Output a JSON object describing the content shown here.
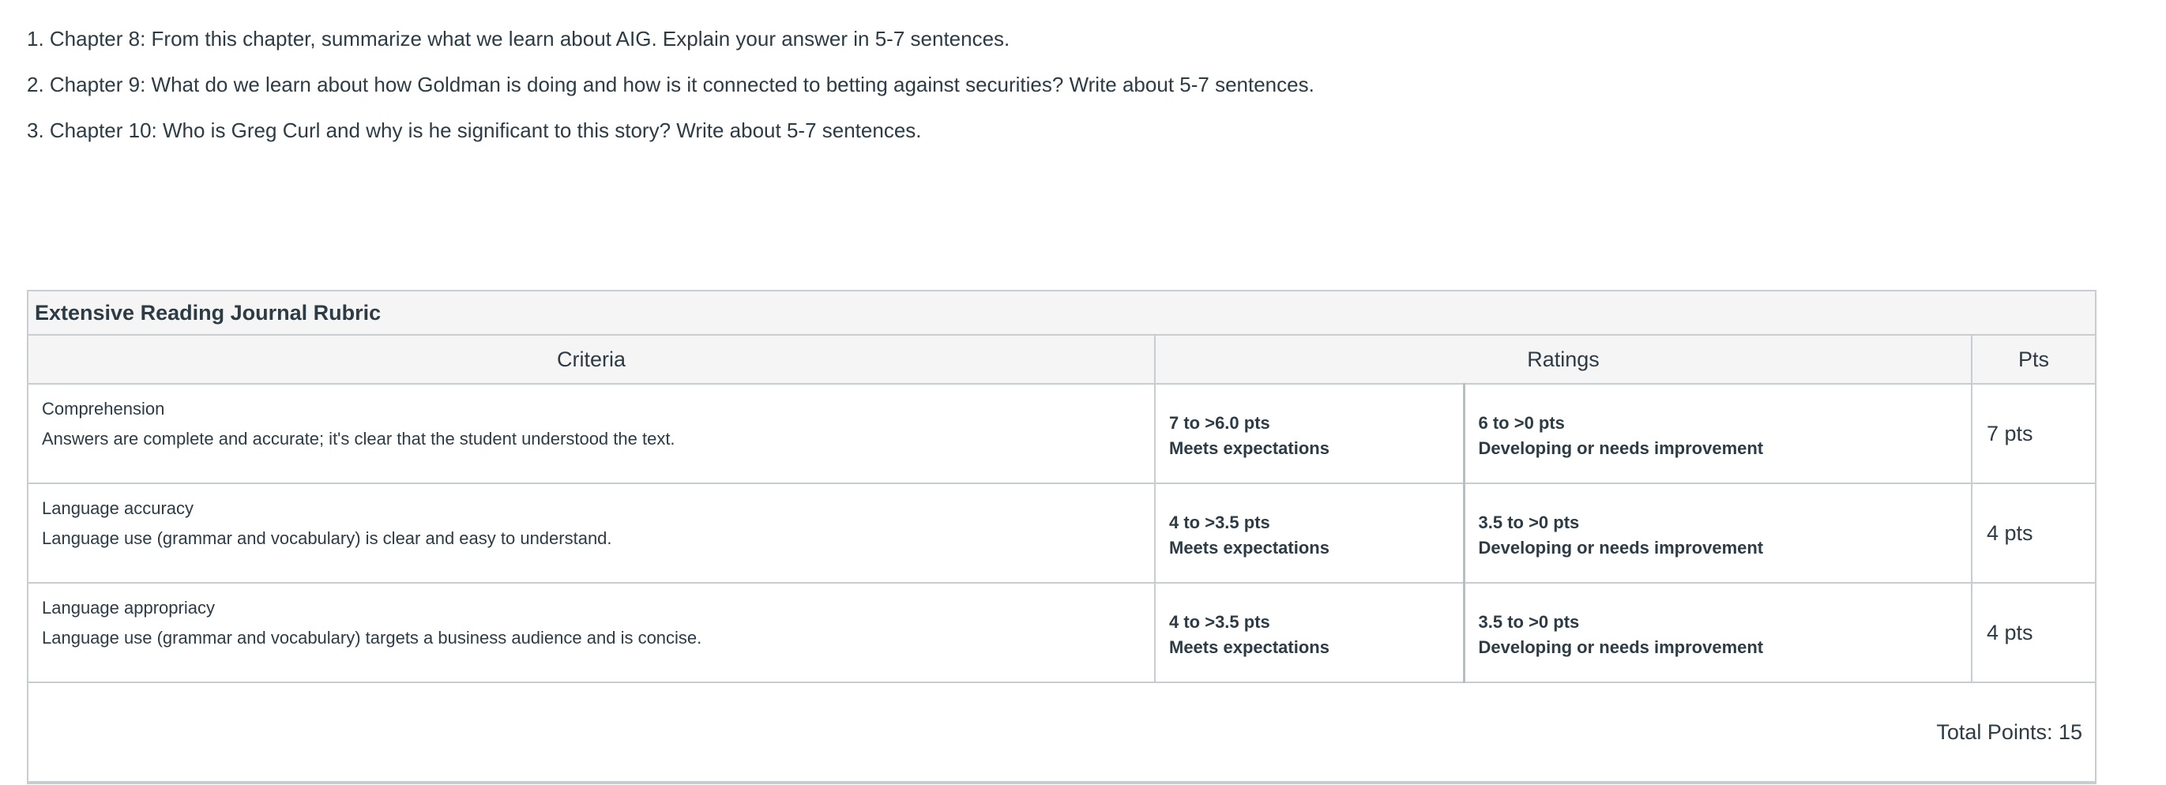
{
  "questions": [
    "1. Chapter 8: From this chapter, summarize what we learn about AIG. Explain your answer in 5-7 sentences.",
    "2. Chapter 9: What do we learn about how Goldman is doing and how is it connected to betting against securities? Write about 5-7 sentences.",
    "3. Chapter 10: Who is Greg Curl and why is he significant to this story? Write about 5-7 sentences."
  ],
  "rubric": {
    "title": "Extensive Reading Journal Rubric",
    "headers": {
      "criteria": "Criteria",
      "ratings": "Ratings",
      "pts": "Pts"
    },
    "rows": [
      {
        "name": "Comprehension",
        "description": "Answers are complete and accurate; it's clear that the student understood the text.",
        "ratings": [
          {
            "points": "7 to >6.0 pts",
            "label": "Meets expectations"
          },
          {
            "points": "6 to >0 pts",
            "label": "Developing or needs improvement"
          }
        ],
        "pts": "7 pts"
      },
      {
        "name": "Language accuracy",
        "description": "Language use (grammar and vocabulary) is clear and easy to understand.",
        "ratings": [
          {
            "points": "4 to >3.5 pts",
            "label": "Meets expectations"
          },
          {
            "points": "3.5 to >0 pts",
            "label": "Developing or needs improvement"
          }
        ],
        "pts": "4 pts"
      },
      {
        "name": "Language appropriacy",
        "description": "Language use (grammar and vocabulary) targets a business audience and is concise.",
        "ratings": [
          {
            "points": "4 to >3.5 pts",
            "label": "Meets expectations"
          },
          {
            "points": "3.5 to >0 pts",
            "label": "Developing or needs improvement"
          }
        ],
        "pts": "4 pts"
      }
    ],
    "total": "Total Points: 15"
  }
}
